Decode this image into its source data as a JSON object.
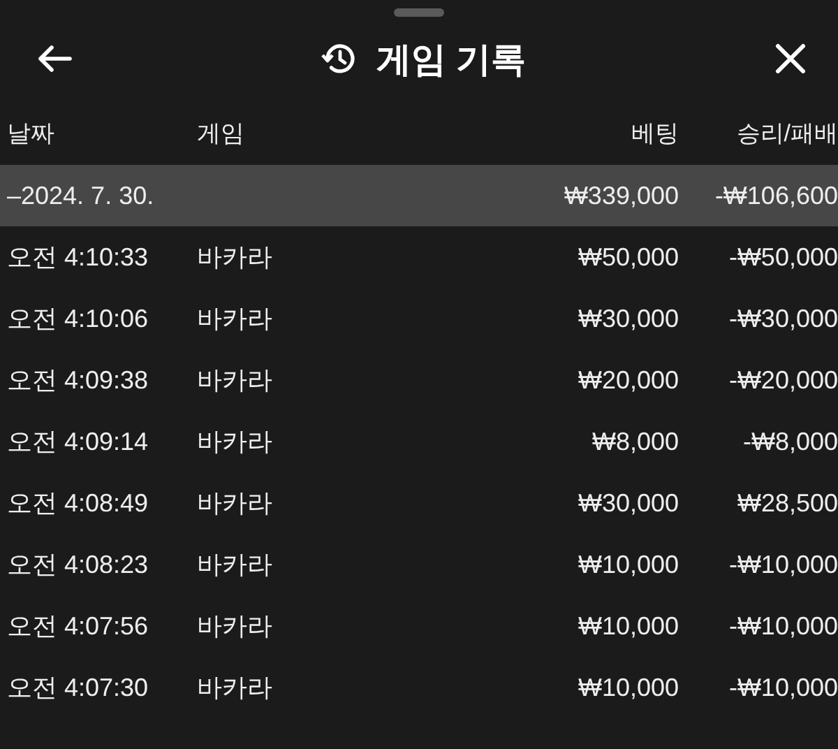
{
  "header": {
    "title": "게임 기록"
  },
  "columns": [
    "날짜",
    "게임",
    "베팅",
    "승리/패배"
  ],
  "group": {
    "date": "–2024. 7. 30.",
    "bet": "₩339,000",
    "result": "-₩106,600"
  },
  "rows": [
    {
      "time": "오전 4:10:33",
      "game": "바카라",
      "bet": "₩50,000",
      "result": "-₩50,000"
    },
    {
      "time": "오전 4:10:06",
      "game": "바카라",
      "bet": "₩30,000",
      "result": "-₩30,000"
    },
    {
      "time": "오전 4:09:38",
      "game": "바카라",
      "bet": "₩20,000",
      "result": "-₩20,000"
    },
    {
      "time": "오전 4:09:14",
      "game": "바카라",
      "bet": "₩8,000",
      "result": "-₩8,000"
    },
    {
      "time": "오전 4:08:49",
      "game": "바카라",
      "bet": "₩30,000",
      "result": "₩28,500"
    },
    {
      "time": "오전 4:08:23",
      "game": "바카라",
      "bet": "₩10,000",
      "result": "-₩10,000"
    },
    {
      "time": "오전 4:07:56",
      "game": "바카라",
      "bet": "₩10,000",
      "result": "-₩10,000"
    },
    {
      "time": "오전 4:07:30",
      "game": "바카라",
      "bet": "₩10,000",
      "result": "-₩10,000"
    }
  ]
}
